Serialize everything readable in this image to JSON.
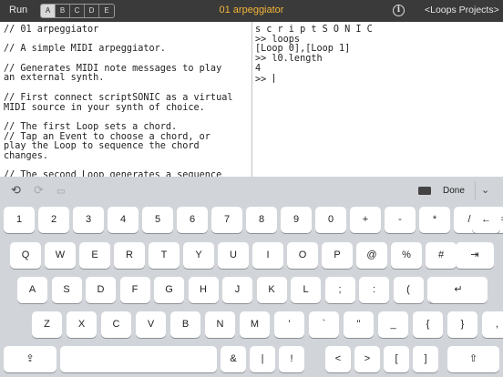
{
  "topbar": {
    "run_label": "Run",
    "slots": [
      "A",
      "B",
      "C",
      "D",
      "E"
    ],
    "active_slot": "A",
    "title": "01 arpeggiator",
    "title_color": "#f4b63a",
    "info_icon": "info-icon",
    "nav_label": "<Loops Projects>"
  },
  "code_lines": [
    "// 01 arpeggiator",
    "",
    "// A simple MIDI arpeggiator.",
    "",
    "// Generates MIDI note messages to play",
    "an external synth.",
    "",
    "// First connect scriptSONIC as a virtual",
    "MIDI source in your synth of choice.",
    "",
    "// The first Loop sets a chord.",
    "// Tap an Event to choose a chord, or",
    "play the Loop to sequence the chord",
    "changes.",
    "",
    "// The second Loop generates a sequence"
  ],
  "console_lines": [
    "s c r i p t S O N I C",
    ">> loops",
    "[Loop 0],[Loop 1]",
    ">> l0.length",
    "4",
    ">> "
  ],
  "toolbar": {
    "undo_icon": "undo-icon",
    "redo_icon": "redo-icon",
    "paste_icon": "paste-icon",
    "keyboard_icon": "keyboard-icon",
    "done_label": "Done",
    "collapse_icon": "chevron-down-icon"
  },
  "keyboard": {
    "row1": [
      "1",
      "2",
      "3",
      "4",
      "5",
      "6",
      "7",
      "8",
      "9",
      "0",
      "+",
      "-",
      "*",
      "/",
      "=",
      "←"
    ],
    "row2": [
      "Q",
      "W",
      "E",
      "R",
      "T",
      "Y",
      "U",
      "I",
      "O",
      "P",
      "@",
      "%",
      "#",
      "$",
      "⇥"
    ],
    "row3": [
      "A",
      "S",
      "D",
      "F",
      "G",
      "H",
      "J",
      "K",
      "L",
      ";",
      ":",
      "(",
      ")",
      "↵"
    ],
    "row4": [
      "Z",
      "X",
      "C",
      "V",
      "B",
      "N",
      "M",
      "'",
      "`",
      "\"",
      "_",
      "{",
      "}",
      ","
    ],
    "row5": [
      "⇪",
      "",
      "&",
      "|",
      "!",
      "<",
      ">",
      "[",
      "]",
      "\\",
      "⇧"
    ]
  }
}
